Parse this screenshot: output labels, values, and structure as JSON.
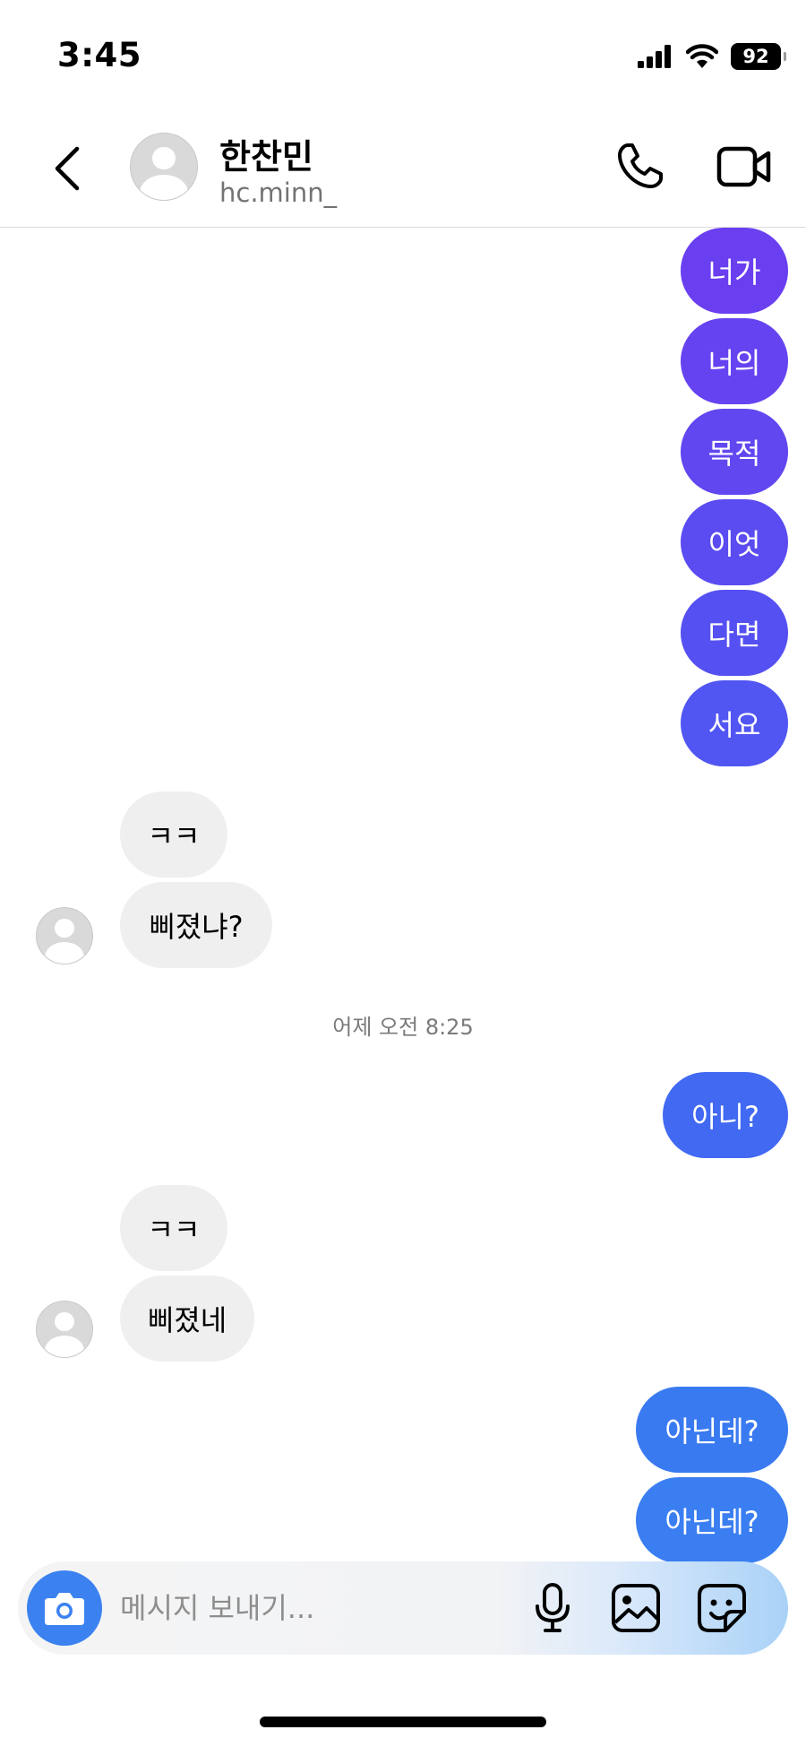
{
  "status_bar": {
    "time": "3:45",
    "battery": "92"
  },
  "header": {
    "name": "한찬민",
    "handle": "hc.minn_"
  },
  "messages": [
    {
      "side": "out",
      "text": "너가",
      "color": "#6a3ff0"
    },
    {
      "side": "out",
      "text": "너의",
      "color": "#6643f0"
    },
    {
      "side": "out",
      "text": "목적",
      "color": "#6047f0"
    },
    {
      "side": "out",
      "text": "이엇",
      "color": "#5a4cf1"
    },
    {
      "side": "out",
      "text": "다면",
      "color": "#5550f1"
    },
    {
      "side": "out",
      "text": "서요",
      "color": "#5155f2"
    },
    {
      "side": "in",
      "text": "ㅋㅋ"
    },
    {
      "side": "in",
      "text": "삐졌냐?"
    },
    {
      "side": "out",
      "text": "아니?",
      "color": "#4169f2"
    },
    {
      "side": "in",
      "text": "ㅋㅋ"
    },
    {
      "side": "in",
      "text": "삐졌네"
    },
    {
      "side": "out",
      "text": "아닌데?",
      "color": "#3a7af1"
    },
    {
      "side": "out",
      "text": "아닌데?",
      "color": "#3a7ef1"
    }
  ],
  "timestamp": "어제 오전 8:25",
  "composer": {
    "placeholder": "메시지 보내기..."
  },
  "colors": {
    "incoming_bubble": "#efefef",
    "camera_button": "#3b82f0"
  },
  "icons": [
    "back-arrow-icon",
    "phone-icon",
    "video-camera-icon",
    "camera-icon",
    "microphone-icon",
    "image-gallery-icon",
    "sticker-icon",
    "signal-icon",
    "wifi-icon",
    "battery-icon"
  ]
}
